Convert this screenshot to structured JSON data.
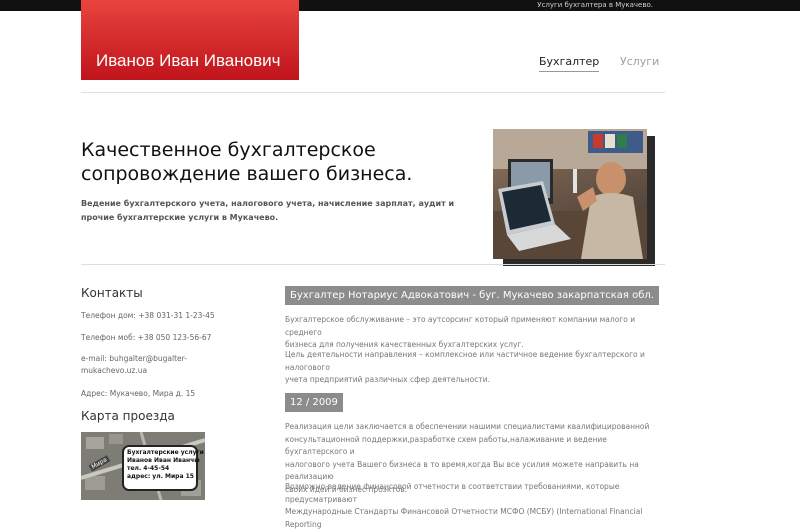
{
  "topbar": {
    "text": "Услуги бухгалтера в Мукачево."
  },
  "logo": {
    "title": "Иванов Иван Иванович"
  },
  "nav": [
    {
      "label": "Бухгалтер",
      "active": true
    },
    {
      "label": "Услуги",
      "active": false
    }
  ],
  "hero": {
    "title_line1": "Качественное бухгалтерское",
    "title_line2": "сопровождение вашего бизнеса.",
    "desc_line1": "Ведение бухгалтерского учета, налогового учета, начисление зарплат, аудит и",
    "desc_line2": "прочие бухгалтерские услуги в Мукачево."
  },
  "sidebar": {
    "contacts_heading": "Контакты",
    "phone_home": "Телефон дом: +38 031-31 1-23-45",
    "phone_mobile": "Телефон моб: +38 050 123-56-67",
    "email_line1": "e-mail: buhgalter@bugalter-",
    "email_line2": "mukachevo.uz.ua",
    "address": "Адрес: Мукачево, Мира д. 15",
    "map_heading": "Карта проезда",
    "map_callout": {
      "line1": "Бухгалтерские услуги",
      "line2": "Иванов Иван Иванчы",
      "line3": "тел. 4-45-54",
      "line4": "адрес: ул. Мира 15"
    },
    "map_street": "Мира"
  },
  "main": {
    "post_title": "Бухгалтер Нотариус Адвокатович - буг. Мукачево закарпатская обл.",
    "para1_line1": "Бухгалтерское обслуживание – это аутсорсинг который применяют компании малого и среднего",
    "para1_line2": "бизнеса для получения качественных бухгалтерских услуг.",
    "para2_line1": "Цель деятельности направления – комплексное или частичное ведение бухгалтерского и налогового",
    "para2_line2": "учета предприятий различных сфер деятельности.",
    "date": "12 / 2009",
    "para3_line1": "Реализация цели заключается в обеспечении нашими специалистами квалифицированной",
    "para3_line2": "консультационной поддержки,разработке схем работы,налаживание и ведение бухгалтерского и",
    "para3_line3": "налогового учета Вашего бизнеса в то время,когда Вы все усилия можете направить на реализацию",
    "para3_line4": "своих идей и бизнес проэктов.",
    "para4_line1": "Возможно ведение финансовой отчетности в соответствии требованиями, которые предусматривают",
    "para4_line2": "Международные Стандарты Финансовой Отчетности МСФО (МСБУ) (International Financial Reporting"
  }
}
